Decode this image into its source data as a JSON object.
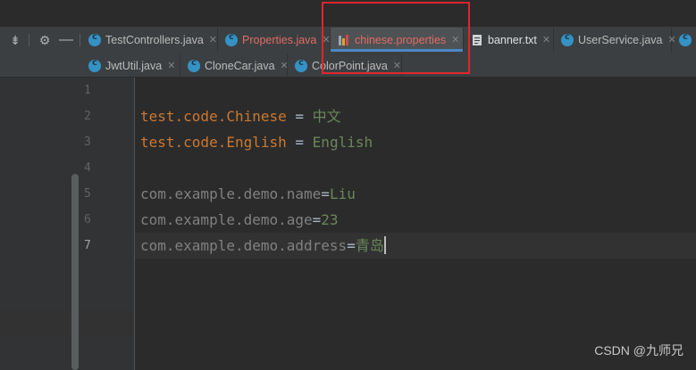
{
  "tabs_row1": [
    {
      "label": "TestControllers.java",
      "icon": "class-icon",
      "style": "normal"
    },
    {
      "label": "Properties.java",
      "icon": "class-icon",
      "style": "red"
    },
    {
      "label": "chinese.properties",
      "icon": "properties-file-icon",
      "style": "red",
      "active": true
    },
    {
      "label": "banner.txt",
      "icon": "text-file-icon",
      "style": "white"
    },
    {
      "label": "UserService.java",
      "icon": "class-icon",
      "style": "normal"
    }
  ],
  "tabs_row2": [
    {
      "label": "JwtUtil.java",
      "icon": "class-icon"
    },
    {
      "label": "CloneCar.java",
      "icon": "class-icon"
    },
    {
      "label": "ColorPoint.java",
      "icon": "class-icon"
    }
  ],
  "line_numbers": [
    "1",
    "2",
    "3",
    "4",
    "5",
    "6",
    "7"
  ],
  "code": {
    "line2_key": "test.code.Chinese",
    "line2_op": " = ",
    "line2_val": "中文",
    "line3_key": "test.code.English",
    "line3_op": " = ",
    "line3_val": "English",
    "line5_key": "com.example.demo.name",
    "line5_op": "=",
    "line5_val": "Liu",
    "line6_key": "com.example.demo.age",
    "line6_op": "=",
    "line6_val": "23",
    "line7_key": "com.example.demo.address",
    "line7_op": "=",
    "line7_val": "青岛"
  },
  "watermark": "CSDN @九师兄",
  "colors": {
    "key": "#cc7832",
    "value": "#6a8759",
    "highlight_box": "#e0262c",
    "active_tab_underline": "#4a88c7"
  }
}
